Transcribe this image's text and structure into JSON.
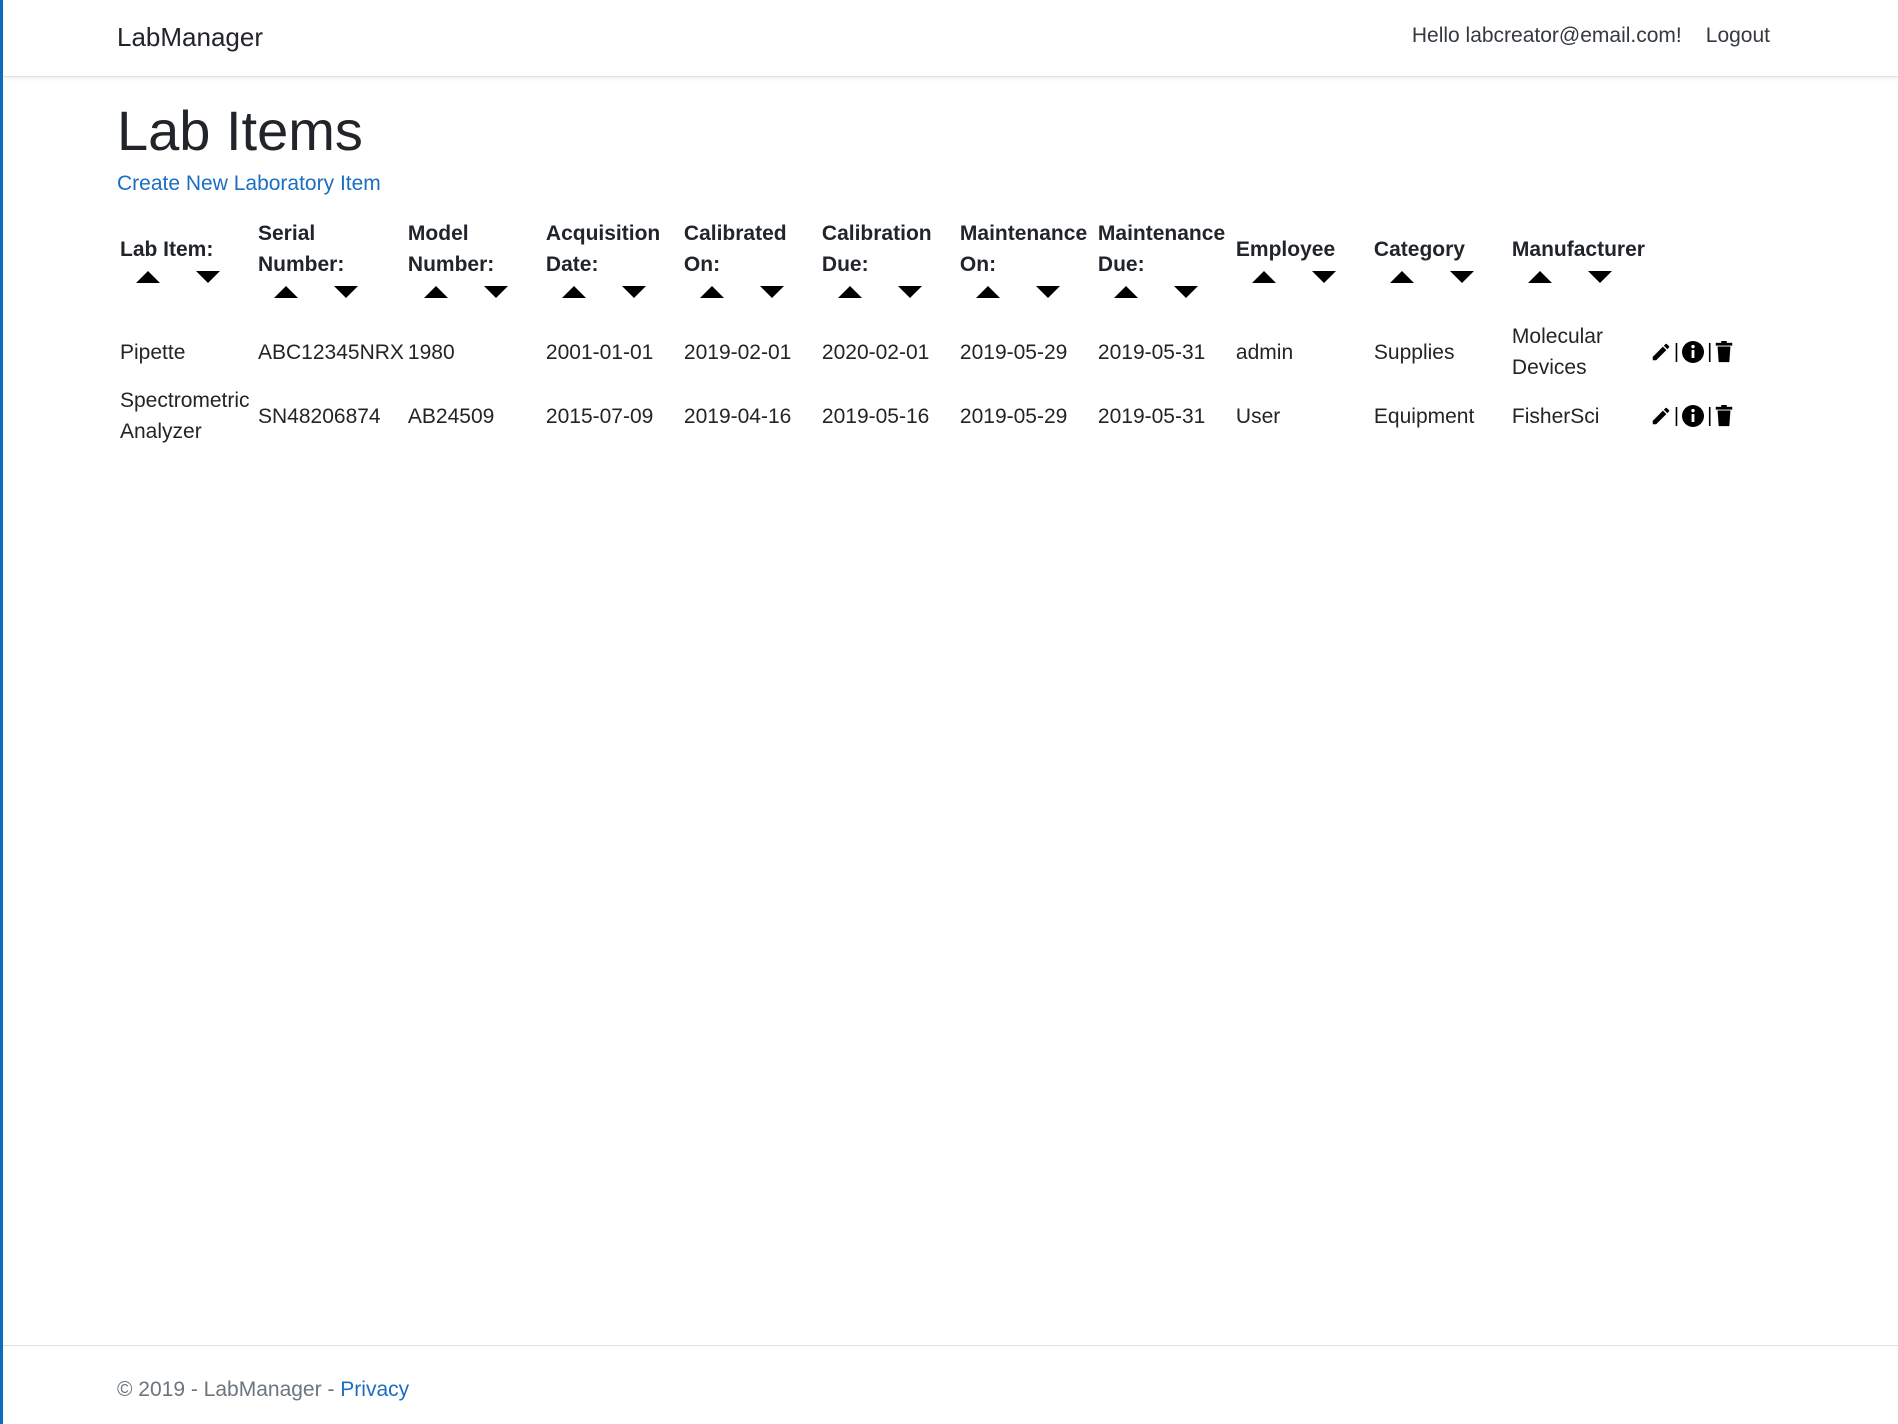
{
  "nav": {
    "brand": "LabManager",
    "greeting": "Hello labcreator@email.com!",
    "logout": "Logout"
  },
  "main": {
    "title": "Lab Items",
    "create_link": "Create New Laboratory Item"
  },
  "table": {
    "columns": [
      "Lab Item:",
      "Serial Number:",
      "Model Number:",
      "Acquisition Date:",
      "Calibrated On:",
      "Calibration Due:",
      "Maintenance On:",
      "Maintenance Due:",
      "Employee",
      "Category",
      "Manufacturer"
    ],
    "rows": [
      [
        "Pipette",
        "ABC12345NRX",
        "1980",
        "2001-01-01",
        "2019-02-01",
        "2020-02-01",
        "2019-05-29",
        "2019-05-31",
        "admin",
        "Supplies",
        "Molecular Devices"
      ],
      [
        "Spectrometric Analyzer",
        "SN48206874",
        "AB24509",
        "2015-07-09",
        "2019-04-16",
        "2019-05-16",
        "2019-05-29",
        "2019-05-31",
        "User",
        "Equipment",
        "FisherSci"
      ]
    ],
    "row_actions": {
      "separator": "|",
      "icons": [
        "pencil-icon",
        "info-icon",
        "trash-icon"
      ]
    }
  },
  "footer": {
    "copyright": "© 2019 - LabManager - ",
    "privacy": "Privacy"
  }
}
